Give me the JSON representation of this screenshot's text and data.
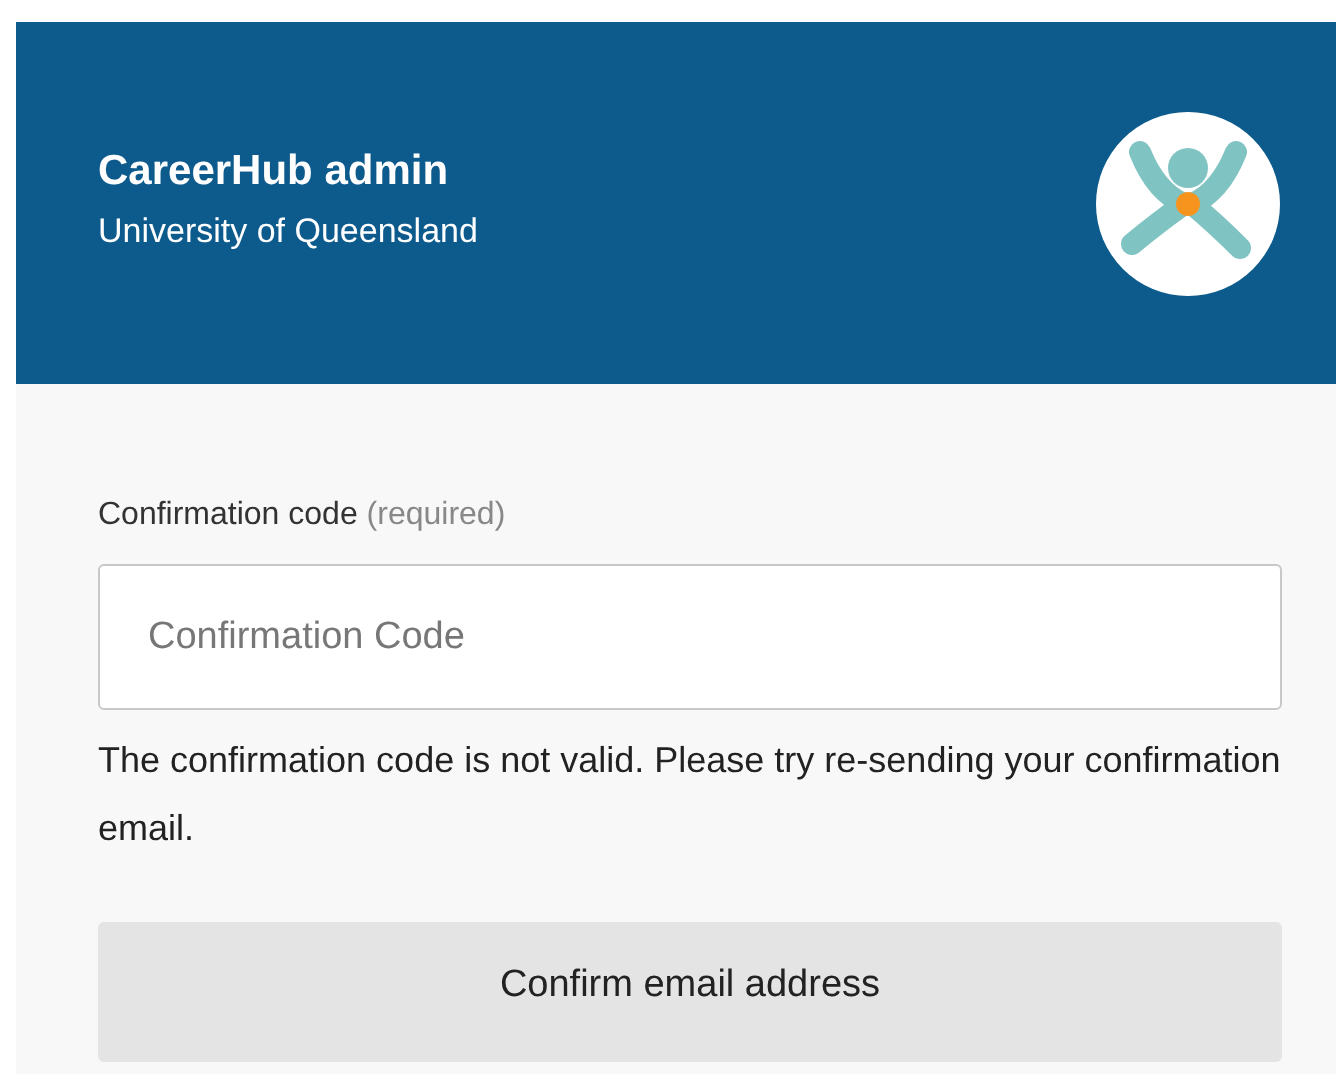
{
  "header": {
    "title": "CareerHub admin",
    "subtitle": "University of Queensland"
  },
  "form": {
    "label": "Confirmation code",
    "label_hint": "(required)",
    "field": {
      "placeholder": "Confirmation Code"
    },
    "error": "The confirmation code is not valid. Please try re-sending your confirmation email.",
    "button": "Confirm email address"
  }
}
